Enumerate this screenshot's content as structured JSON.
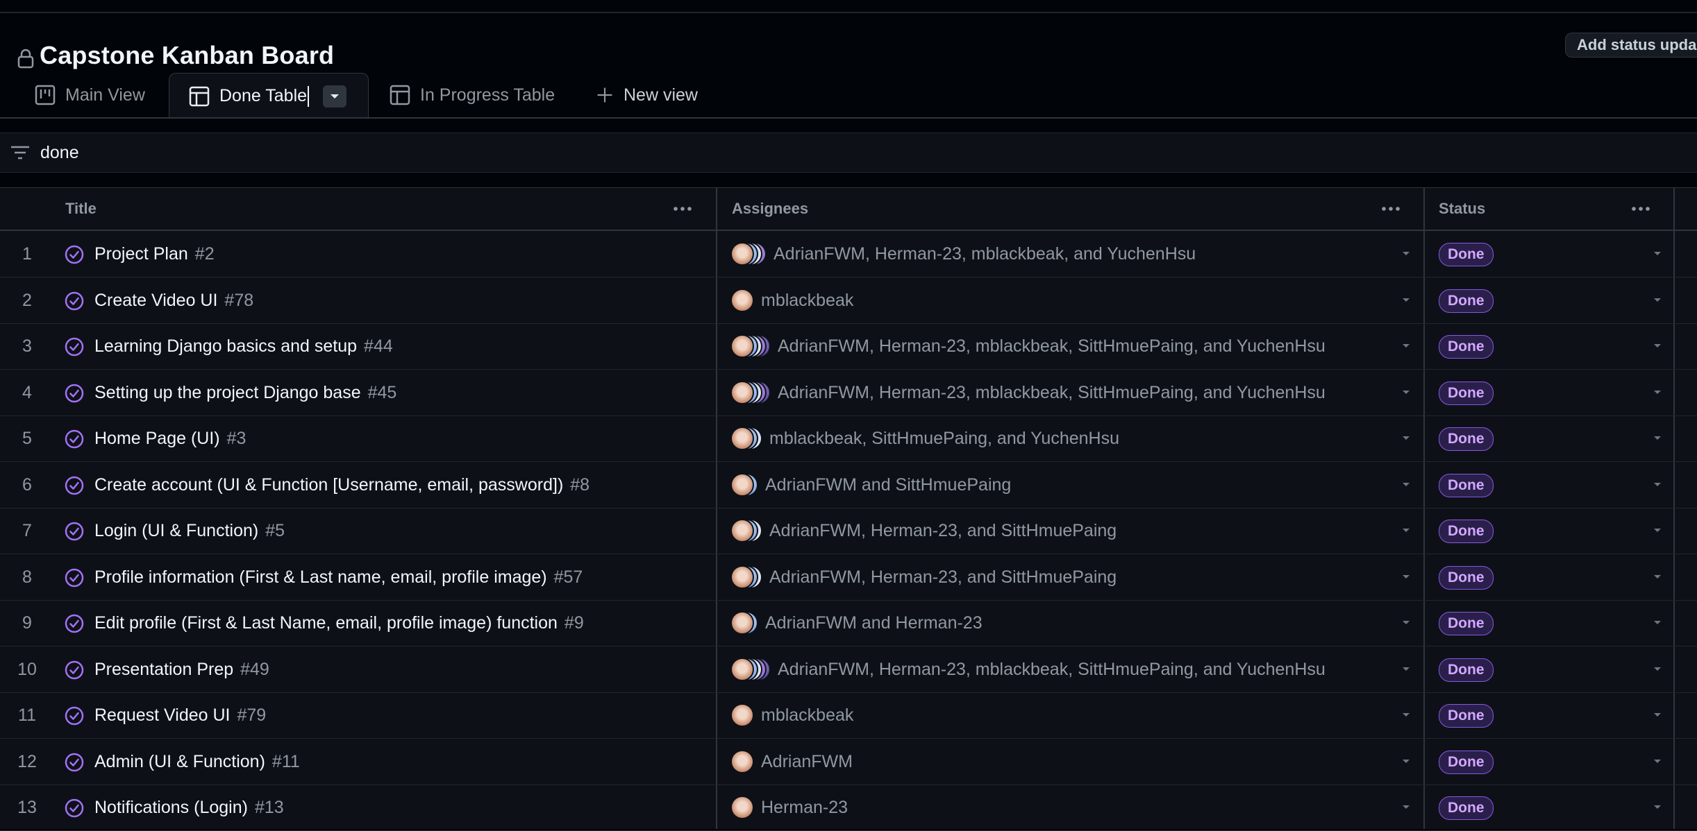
{
  "header": {
    "title": "Capstone Kanban Board",
    "status_button": "Add status upda"
  },
  "tabs": [
    {
      "label": "Main View",
      "icon": "board-icon"
    },
    {
      "label": "Done Table",
      "icon": "table-icon",
      "active": true
    },
    {
      "label": "In Progress Table",
      "icon": "table-icon"
    },
    {
      "label": "New view",
      "icon": "plus-icon"
    }
  ],
  "filter": {
    "value": "done"
  },
  "columns": {
    "title": "Title",
    "assignees": "Assignees",
    "status": "Status"
  },
  "rows": [
    {
      "n": "1",
      "title": "Project Plan",
      "num": "#2",
      "assignees": "AdrianFWM, Herman-23, mblackbeak, and YuchenHsu",
      "avatars": 4,
      "status": "Done"
    },
    {
      "n": "2",
      "title": "Create Video UI",
      "num": "#78",
      "assignees": "mblackbeak",
      "avatars": 1,
      "status": "Done"
    },
    {
      "n": "3",
      "title": "Learning Django basics and setup",
      "num": "#44",
      "assignees": "AdrianFWM, Herman-23, mblackbeak, SittHmuePaing, and YuchenHsu",
      "avatars": 5,
      "status": "Done"
    },
    {
      "n": "4",
      "title": "Setting up the project Django base",
      "num": "#45",
      "assignees": "AdrianFWM, Herman-23, mblackbeak, SittHmuePaing, and YuchenHsu",
      "avatars": 5,
      "status": "Done"
    },
    {
      "n": "5",
      "title": "Home Page (UI)",
      "num": "#3",
      "assignees": "mblackbeak, SittHmuePaing, and YuchenHsu",
      "avatars": 3,
      "status": "Done"
    },
    {
      "n": "6",
      "title": "Create account (UI & Function [Username, email, password])",
      "num": "#8",
      "assignees": "AdrianFWM and SittHmuePaing",
      "avatars": 2,
      "status": "Done"
    },
    {
      "n": "7",
      "title": "Login (UI & Function)",
      "num": "#5",
      "assignees": "AdrianFWM, Herman-23, and SittHmuePaing",
      "avatars": 3,
      "status": "Done"
    },
    {
      "n": "8",
      "title": "Profile information (First & Last name, email, profile image)",
      "num": "#57",
      "assignees": "AdrianFWM, Herman-23, and SittHmuePaing",
      "avatars": 3,
      "status": "Done"
    },
    {
      "n": "9",
      "title": "Edit profile (First & Last Name, email, profile image) function",
      "num": "#9",
      "assignees": "AdrianFWM and Herman-23",
      "avatars": 2,
      "status": "Done"
    },
    {
      "n": "10",
      "title": "Presentation Prep",
      "num": "#49",
      "assignees": "AdrianFWM, Herman-23, mblackbeak, SittHmuePaing, and YuchenHsu",
      "avatars": 5,
      "status": "Done"
    },
    {
      "n": "11",
      "title": "Request Video UI",
      "num": "#79",
      "assignees": "mblackbeak",
      "avatars": 1,
      "status": "Done"
    },
    {
      "n": "12",
      "title": "Admin (UI & Function)",
      "num": "#11",
      "assignees": "AdrianFWM",
      "avatars": 1,
      "status": "Done"
    },
    {
      "n": "13",
      "title": "Notifications (Login)",
      "num": "#13",
      "assignees": "Herman-23",
      "avatars": 1,
      "status": "Done"
    }
  ],
  "colors": {
    "background": "#010409",
    "done_badge": "#8957e5",
    "check": "#a371f7"
  }
}
